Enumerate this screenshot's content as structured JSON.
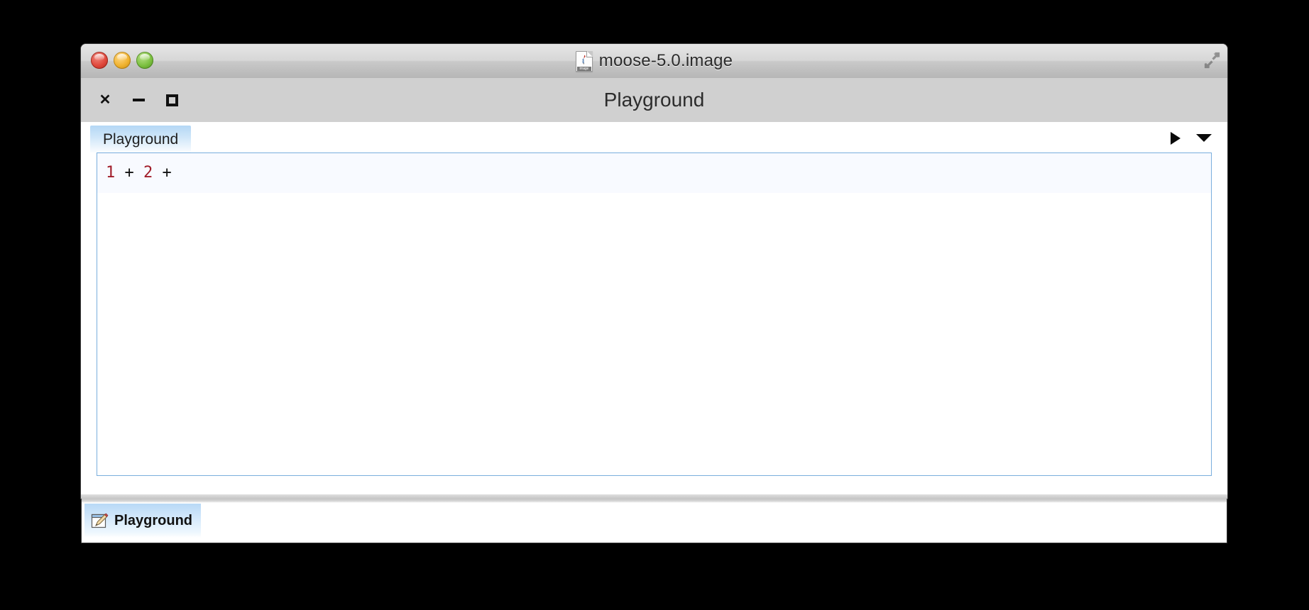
{
  "os_window": {
    "title": "moose-5.0.image",
    "doc_icon_label": "image",
    "traffic_lights": [
      {
        "name": "close",
        "color": "#e0483c"
      },
      {
        "name": "minimize",
        "color": "#f0b330"
      },
      {
        "name": "zoom",
        "color": "#7cc040"
      }
    ],
    "fullscreen_icon": "expand-arrows-icon"
  },
  "app_window": {
    "title": "Playground",
    "controls": [
      {
        "name": "close",
        "glyph": "×"
      },
      {
        "name": "minimize",
        "glyph": "–"
      },
      {
        "name": "maximize",
        "glyph": "□"
      }
    ]
  },
  "tabbar": {
    "tabs": [
      {
        "label": "Playground",
        "active": true
      }
    ],
    "actions": [
      {
        "name": "run-button",
        "icon": "play-triangle-icon"
      },
      {
        "name": "run-options-button",
        "icon": "chevron-down-icon"
      }
    ]
  },
  "editor": {
    "tokens": [
      {
        "text": "1",
        "type": "num"
      },
      {
        "text": " ",
        "type": "ws"
      },
      {
        "text": "+",
        "type": "op"
      },
      {
        "text": " ",
        "type": "ws"
      },
      {
        "text": "2",
        "type": "num"
      },
      {
        "text": " ",
        "type": "ws"
      },
      {
        "text": "+",
        "type": "op"
      }
    ],
    "source": "1 + 2 +",
    "current_line_color": "#f8faff",
    "border_color": "#7aaedd",
    "number_color": "#a11d2a",
    "operator_color": "#111111"
  },
  "taskbar": {
    "items": [
      {
        "label": "Playground",
        "icon": "pencil-document-icon",
        "active": true
      }
    ]
  },
  "theme": {
    "desktop_background": "#000000",
    "window_chrome": "#d0d0d0",
    "tab_accent": "#b4d7f5"
  }
}
